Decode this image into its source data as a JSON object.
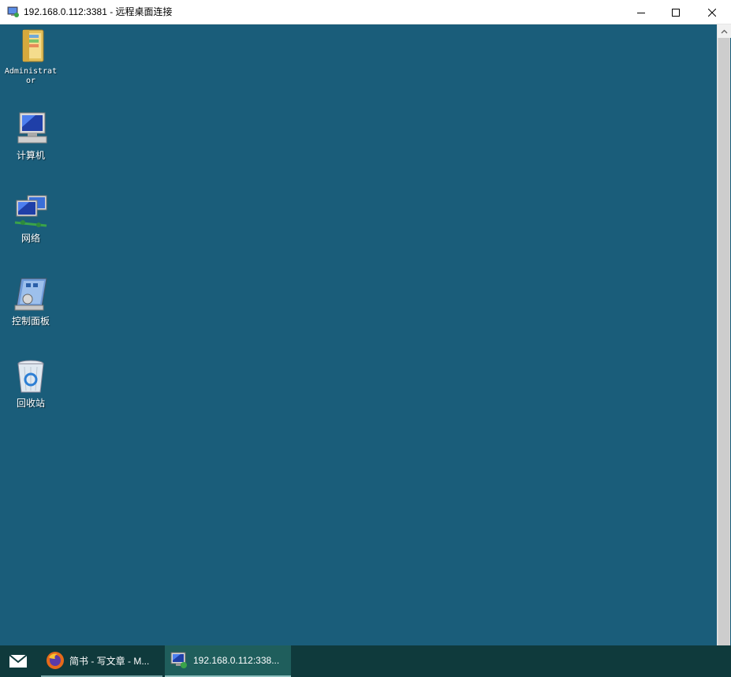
{
  "window": {
    "title": "192.168.0.112:3381 - 远程桌面连接",
    "icon": "remote-desktop-icon",
    "controls": [
      "minimize",
      "maximize",
      "close"
    ]
  },
  "desktop": {
    "background": "#1a5d7a",
    "icons": [
      {
        "name": "user-folder",
        "label": "Administrator"
      },
      {
        "name": "computer",
        "label": "计算机"
      },
      {
        "name": "network",
        "label": "网络"
      },
      {
        "name": "control-panel",
        "label": "控制面板"
      },
      {
        "name": "recycle-bin",
        "label": "回收站"
      }
    ]
  },
  "taskbar": {
    "background": "#0f3a3c",
    "mail_icon": "mail-icon",
    "apps": [
      {
        "label": "简书 - 写文章 - M...",
        "icon": "firefox-icon",
        "active": false
      },
      {
        "label": "192.168.0.112:338...",
        "icon": "remote-desktop-icon",
        "active": true
      }
    ]
  }
}
